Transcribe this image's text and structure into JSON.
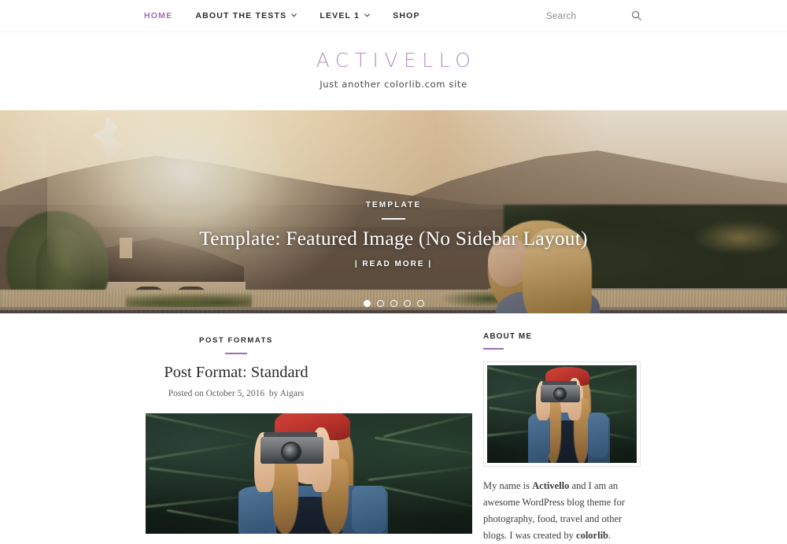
{
  "nav": {
    "items": [
      {
        "label": "HOME",
        "active": true,
        "caret": false
      },
      {
        "label": "ABOUT THE TESTS",
        "active": false,
        "caret": true
      },
      {
        "label": "LEVEL 1",
        "active": false,
        "caret": true
      },
      {
        "label": "SHOP",
        "active": false,
        "caret": false
      }
    ]
  },
  "search": {
    "placeholder": "Search",
    "value": "",
    "icon": "search-icon"
  },
  "branding": {
    "site_title": "Activello",
    "site_description": "Just another colorlib.com site"
  },
  "hero": {
    "category": "TEMPLATE",
    "title": "Template: Featured Image (No Sidebar Layout)",
    "read_more": "| READ MORE |",
    "dots": [
      {
        "active": true
      },
      {
        "active": false
      },
      {
        "active": false
      },
      {
        "active": false
      },
      {
        "active": false
      }
    ],
    "image_alt": "Woman riding a bicycle on a road at sunset with mountains and a house"
  },
  "post": {
    "category": "POST FORMATS",
    "title": "Post Format: Standard",
    "meta_posted": "Posted on October 5, 2016",
    "meta_by": "by Aigars",
    "image_alt": "Woman in a red beanie and denim jacket holding a film camera in front of pine trees"
  },
  "sidebar": {
    "widget_title": "ABOUT ME",
    "image_alt": "Woman in a red beanie taking a photo with a film camera",
    "about_text_1": "My name is ",
    "about_name": "Activello",
    "about_text_2": " and I am an awesome WordPress blog theme for photography, food, travel and other blogs. I was created by ",
    "about_link": "colorlib",
    "about_text_3": "."
  },
  "colors": {
    "accent": "#9b6fb0",
    "title_purple": "#b293c6",
    "text": "#2b2b2b",
    "meta": "#5e5e5e",
    "border": "#f4f4f4"
  }
}
